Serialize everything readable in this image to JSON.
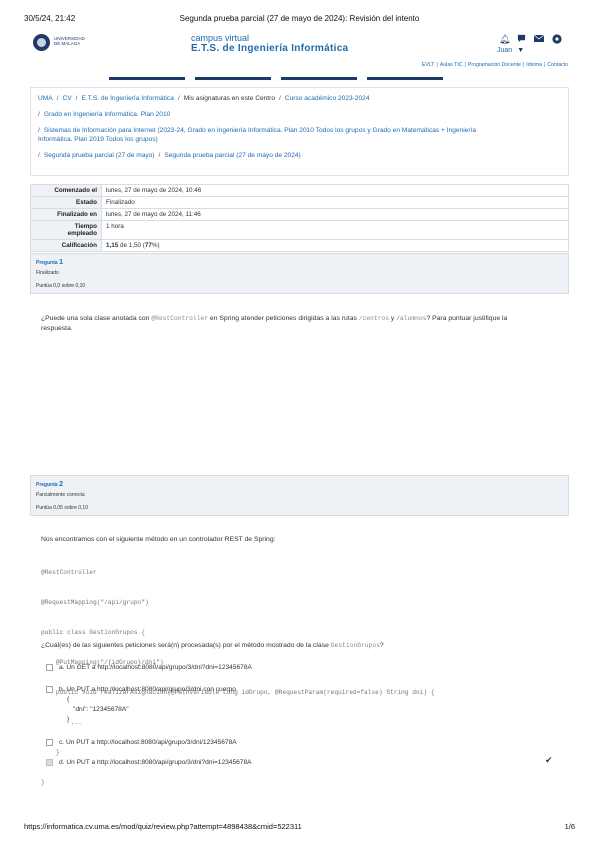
{
  "print": {
    "date": "30/5/24, 21:42",
    "title": "Segunda prueba parcial (27 de mayo de 2024): Revisión del intento",
    "url": "https://informatica.cv.uma.es/mod/quiz/review.php?attempt=4898438&cmid=522311",
    "page": "1/6"
  },
  "header": {
    "logo_line1": "UNIVERSIDAD",
    "logo_line2": "DE MÁLAGA",
    "site_line1": "campus virtual",
    "site_line2": "E.T.S. de Ingeniería Informática",
    "user_name": "Juan",
    "icons": [
      "bell-icon",
      "comment-icon",
      "envelope-icon",
      "settings-icon"
    ],
    "links": [
      "EVLT",
      "Aulas TIC",
      "Programación Docente",
      "Idioma",
      "Contacto"
    ],
    "bar_colors": [
      "#ffffff",
      "#1e3a66",
      "#ffffff",
      "#1e3a66",
      "#ffffff",
      "#1e3a66",
      "#ffffff",
      "#1e3a66",
      "#ffffff"
    ]
  },
  "breadcrumb": {
    "row1": [
      "UMA",
      "CV",
      "E.T.S. de Ingeniería Informática",
      "Mis asignaturas en este Centro",
      "Curso académico 2023-2024"
    ],
    "row2": "Grado en Ingeniería Informática. Plan 2010",
    "row3a": "Sistemas de Información para Internet (2023-24, Grado en Ingeniería Informática. Plan 2010 Todos los grupos y Grado en Matemáticas + Ingeniería",
    "row3b": "Informática. Plan 2019 Todos los grupos)",
    "row4": [
      "Segunda prueba parcial (27 de mayo)",
      "Segunda prueba parcial (27 de mayo de 2024)"
    ]
  },
  "summary": {
    "started_label": "Comenzado el",
    "started_value": "lunes, 27 de mayo de 2024, 10:46",
    "state_label": "Estado",
    "state_value": "Finalizado",
    "finished_label": "Finalizado en",
    "finished_value": "lunes, 27 de mayo de 2024, 11:46",
    "time_label_1": "Tiempo",
    "time_label_2": "empleado",
    "time_value": "1 hora",
    "grade_label": "Calificación",
    "grade_score": "1,15",
    "grade_rest": " de 1,50 (",
    "grade_pct": "77",
    "grade_end": "%)"
  },
  "q1": {
    "prefix": "Pregunta",
    "number": "1",
    "status": "Finalizado",
    "points": "Puntúa 0,0 sobre 0,10",
    "text_a": "¿Puede una sola clase anotada con ",
    "code_a": "@RestController",
    "text_b": " en Spring atender peticiones dirigidas a las rutas ",
    "code_b": "/centros",
    "text_c": " y ",
    "code_c": "/alumnos",
    "text_d": "? Para puntuar justifique la",
    "text_e": "respuesta."
  },
  "q2": {
    "prefix": "Pregunta",
    "number": "2",
    "status": "Parcialmente correcta",
    "points": "Puntúa 0,05 sobre 0,10",
    "intro": "Nos encontramos con el siguiente método en un controlador REST de Spring:",
    "code": [
      "@RestController",
      "@RequestMapping(\"/api/grupo\")",
      "public class GestionGrupos {",
      "    @PutMapping(\"/{idGrupo}/dni\")",
      "    public void realizarAsignacion(@PathVariable Long idGrupo, @RequestParam(required=false) String dni) {",
      "        ...",
      "    }",
      "}"
    ],
    "question_a": "¿Cuál(es) de las siguientes peticiones será(n) procesada(s) por el método mostrado de la clase ",
    "question_code": "GestionGrupos",
    "question_b": "?",
    "options": [
      {
        "label": "a. Un GET a http://localhost:8080/api/grupo/3/dni?dni=12345678A"
      },
      {
        "label": "b. Un PUT a http://localhost:8080/api/grupo/3/dni con cuerpo",
        "body": [
          "{",
          "\"dni\": \"12345678A\"",
          "}"
        ]
      },
      {
        "label": "c. Un PUT a http://localhost:8080/api/grupo/3/dni/12345678A"
      },
      {
        "label": "d. Un PUT a http://localhost:8080/api/grupo/3/dni?dni=12345678A"
      }
    ],
    "correct_mark": "✔"
  }
}
